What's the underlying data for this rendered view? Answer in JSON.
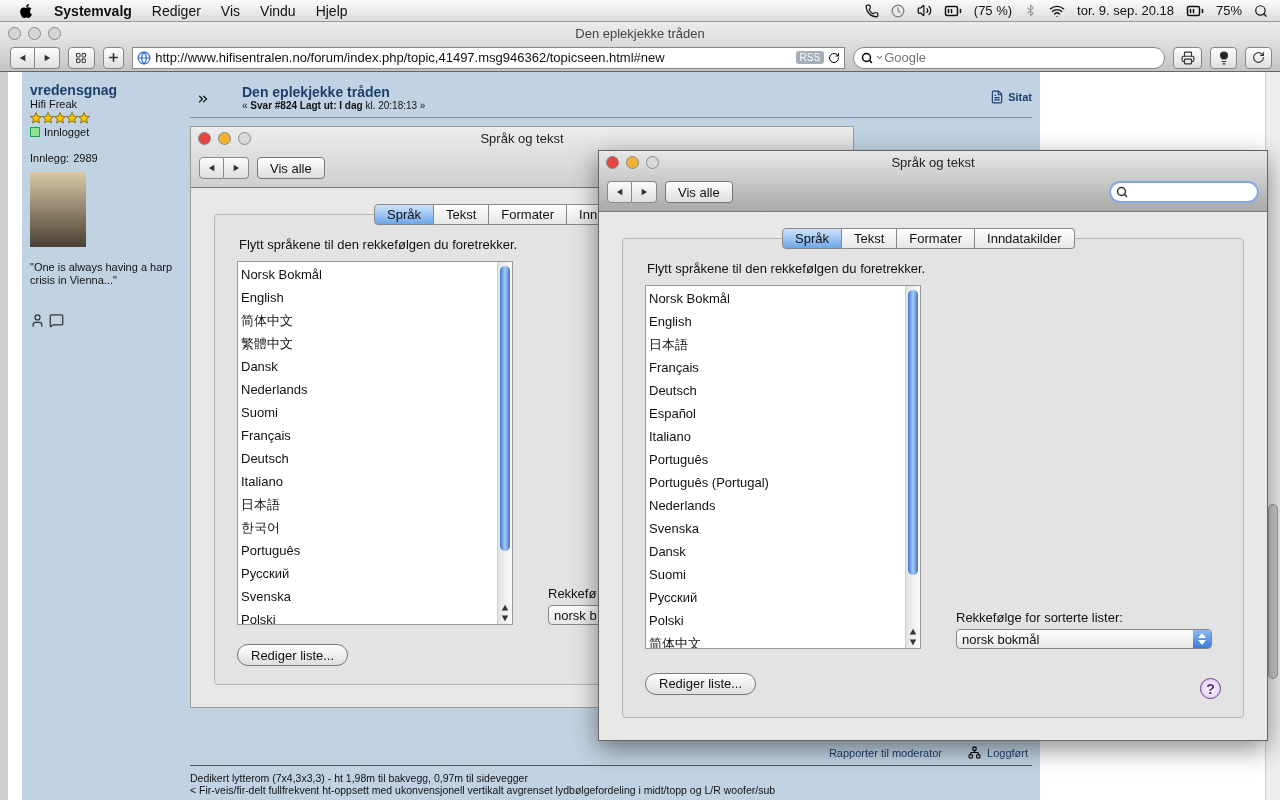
{
  "menubar": {
    "app": "Systemvalg",
    "menus": [
      "Rediger",
      "Vis",
      "Vindu",
      "Hjelp"
    ],
    "battery_reading": "(75 %)",
    "clock": "tor. 9. sep. 20.18",
    "battery_percent": "75%"
  },
  "browser": {
    "title": "Den eplekjekke tråden",
    "url": "http://www.hifisentralen.no/forum/index.php/topic,41497.msg946362/topicseen.html#new",
    "rss": "RSS",
    "search": {
      "placeholder": "Google"
    }
  },
  "post": {
    "author": {
      "name": "vredensgnag",
      "rank": "Hifi Freak",
      "stars": 5,
      "status": "Innlogget",
      "posts_label": "Innlegg:",
      "posts": "2989",
      "quote": "\"One is always having a harp crisis in Vienna...\""
    },
    "title": "Den eplekjekke tråden",
    "meta": "« **Svar #824 Lagt ut: I dag** kl. 20:18:13 »",
    "quote_button": "Sitat",
    "screenshot": {
      "title": "Språk og tekst",
      "show_all": "Vis alle",
      "tabs": [
        {
          "label": "Språk",
          "selected": true
        },
        {
          "label": "Tekst",
          "selected": false
        },
        {
          "label": "Formater",
          "selected": false
        },
        {
          "label": "Inn",
          "selected": false
        }
      ],
      "instruction": "Flytt språkene til den rekkefølgen du foretrekker.",
      "languages": [
        "Norsk Bokmål",
        "English",
        "简体中文",
        "繁體中文",
        "Dansk",
        "Nederlands",
        "Suomi",
        "Français",
        "Deutsch",
        "Italiano",
        "日本語",
        "한국어",
        "Português",
        "Русский",
        "Svenska",
        "Polski"
      ],
      "edit_button": "Rediger liste...",
      "sort_label": "Rekkefø",
      "sort_value": "norsk b"
    },
    "report": "Rapporter til moderator",
    "logged": "Loggført",
    "signature": [
      "Dedikert lytterom (7x4,3x3,3) - ht 1,98m til bakvegg, 0,97m til sidevegger",
      "< Fir-veis/fir-delt fullfrekvent ht-oppsett med ukonvensjonell vertikalt avgrenset lydbølgefordeling i midt/topp og L/R woofer/sub"
    ]
  },
  "window": {
    "title": "Språk og tekst",
    "show_all": "Vis alle",
    "search_field": true,
    "tabs": [
      {
        "label": "Språk",
        "selected": true
      },
      {
        "label": "Tekst",
        "selected": false
      },
      {
        "label": "Formater",
        "selected": false
      },
      {
        "label": "Inndatakilder",
        "selected": false
      }
    ],
    "instruction": "Flytt språkene til den rekkefølgen du foretrekker.",
    "languages": [
      "Norsk Bokmål",
      "English",
      "日本語",
      "Français",
      "Deutsch",
      "Español",
      "Italiano",
      "Português",
      "Português (Portugal)",
      "Nederlands",
      "Svenska",
      "Dansk",
      "Suomi",
      "Русский",
      "Polski",
      "简体中文"
    ],
    "edit_button": "Rediger liste...",
    "sort_label": "Rekkefølge for sorterte lister:",
    "sort_value": "norsk bokmål",
    "help": "?"
  }
}
